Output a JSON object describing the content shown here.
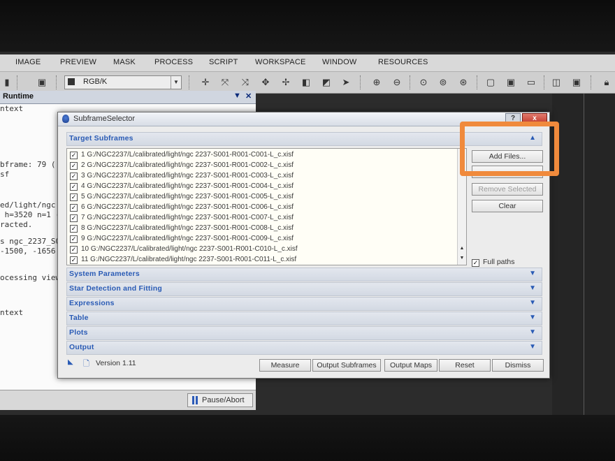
{
  "menubar": {
    "items": [
      "IMAGE",
      "PREVIEW",
      "MASK",
      "PROCESS",
      "SCRIPT",
      "WORKSPACE",
      "WINDOW",
      "RESOURCES"
    ]
  },
  "toolbar": {
    "color_space": "RGB/K"
  },
  "console": {
    "title": "Runtime",
    "lines": [
      "ntext",
      "",
      "",
      "",
      "bframe: 79 (",
      "sf",
      "",
      "",
      "ed/light/ngc",
      " h=3520 n=1 (",
      "racted.",
      "",
      "s ngc_2237_S0",
      "-1500, -1656.",
      "",
      "",
      "ocessing view",
      "",
      "",
      "",
      "ntext"
    ],
    "pause_label": "Pause/Abort"
  },
  "dialog": {
    "title": "SubframeSelector",
    "help_label": "?",
    "close_label": "x",
    "target_section": "Target Subframes",
    "files": [
      "1 G:/NGC2237/L/calibrated/light/ngc 2237-S001-R001-C001-L_c.xisf",
      "2 G:/NGC2237/L/calibrated/light/ngc 2237-S001-R001-C002-L_c.xisf",
      "3 G:/NGC2237/L/calibrated/light/ngc 2237-S001-R001-C003-L_c.xisf",
      "4 G:/NGC2237/L/calibrated/light/ngc 2237-S001-R001-C004-L_c.xisf",
      "5 G:/NGC2237/L/calibrated/light/ngc 2237-S001-R001-C005-L_c.xisf",
      "6 G:/NGC2237/L/calibrated/light/ngc 2237-S001-R001-C006-L_c.xisf",
      "7 G:/NGC2237/L/calibrated/light/ngc 2237-S001-R001-C007-L_c.xisf",
      "8 G:/NGC2237/L/calibrated/light/ngc 2237-S001-R001-C008-L_c.xisf",
      "9 G:/NGC2237/L/calibrated/light/ngc 2237-S001-R001-C009-L_c.xisf",
      "10 G:/NGC2237/L/calibrated/light/ngc 2237-S001-R001-C010-L_c.xisf",
      "11 G:/NGC2237/L/calibrated/light/ngc 2237-S001-R001-C011-L_c.xisf"
    ],
    "buttons": {
      "add_files": "Add Files...",
      "remove_selected": "Remove Selected",
      "clear": "Clear"
    },
    "full_paths_label": "Full paths",
    "sections": [
      "System Parameters",
      "Star Detection and Fitting",
      "Expressions",
      "Table",
      "Plots",
      "Output"
    ],
    "version": "Version 1.11",
    "bottom_buttons": [
      "Measure",
      "Output Subframes",
      "Output Maps",
      "Reset",
      "Dismiss"
    ]
  },
  "annotation": {
    "highlight_color": "#f08a3c"
  }
}
